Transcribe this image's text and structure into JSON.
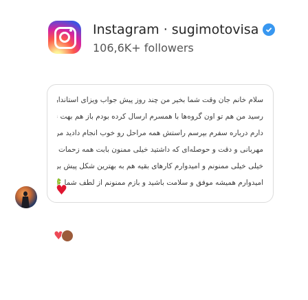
{
  "header": {
    "title": "Instagram · sugimotovisa",
    "followers": "106,6K+ followers",
    "logo_icon": "instagram-logo-icon",
    "verified_icon": "verified-badge-icon",
    "verified_color": "#3897f0"
  },
  "message": {
    "lines": [
      "سلام خانم جان وقت شما بخیر من چند روز پیش جواب ویزای استانداردم",
      "رسید من هم تو اون گروه‌ها با همسرم ارسال کرده بودم باز هم بهت نیاز",
      "دارم درباره سفرم بپرسم راستش همه مراحل رو خوب انجام دادید مرسی از",
      "مهربانی و دقت و حوصله‌ای که داشتید خیلی ممنون بابت همه زحمات شما",
      "خیلی خیلی ممنونم و امیدوارم کارهای بقیه هم به بهترین شکل پیش بره",
      "امیدوارم همیشه موفق و سلامت باشید و بازم ممنونم از لطف شما 🍀"
    ],
    "heart_mark": "♥",
    "reaction_heart": "♥",
    "accent": "#e01530"
  }
}
